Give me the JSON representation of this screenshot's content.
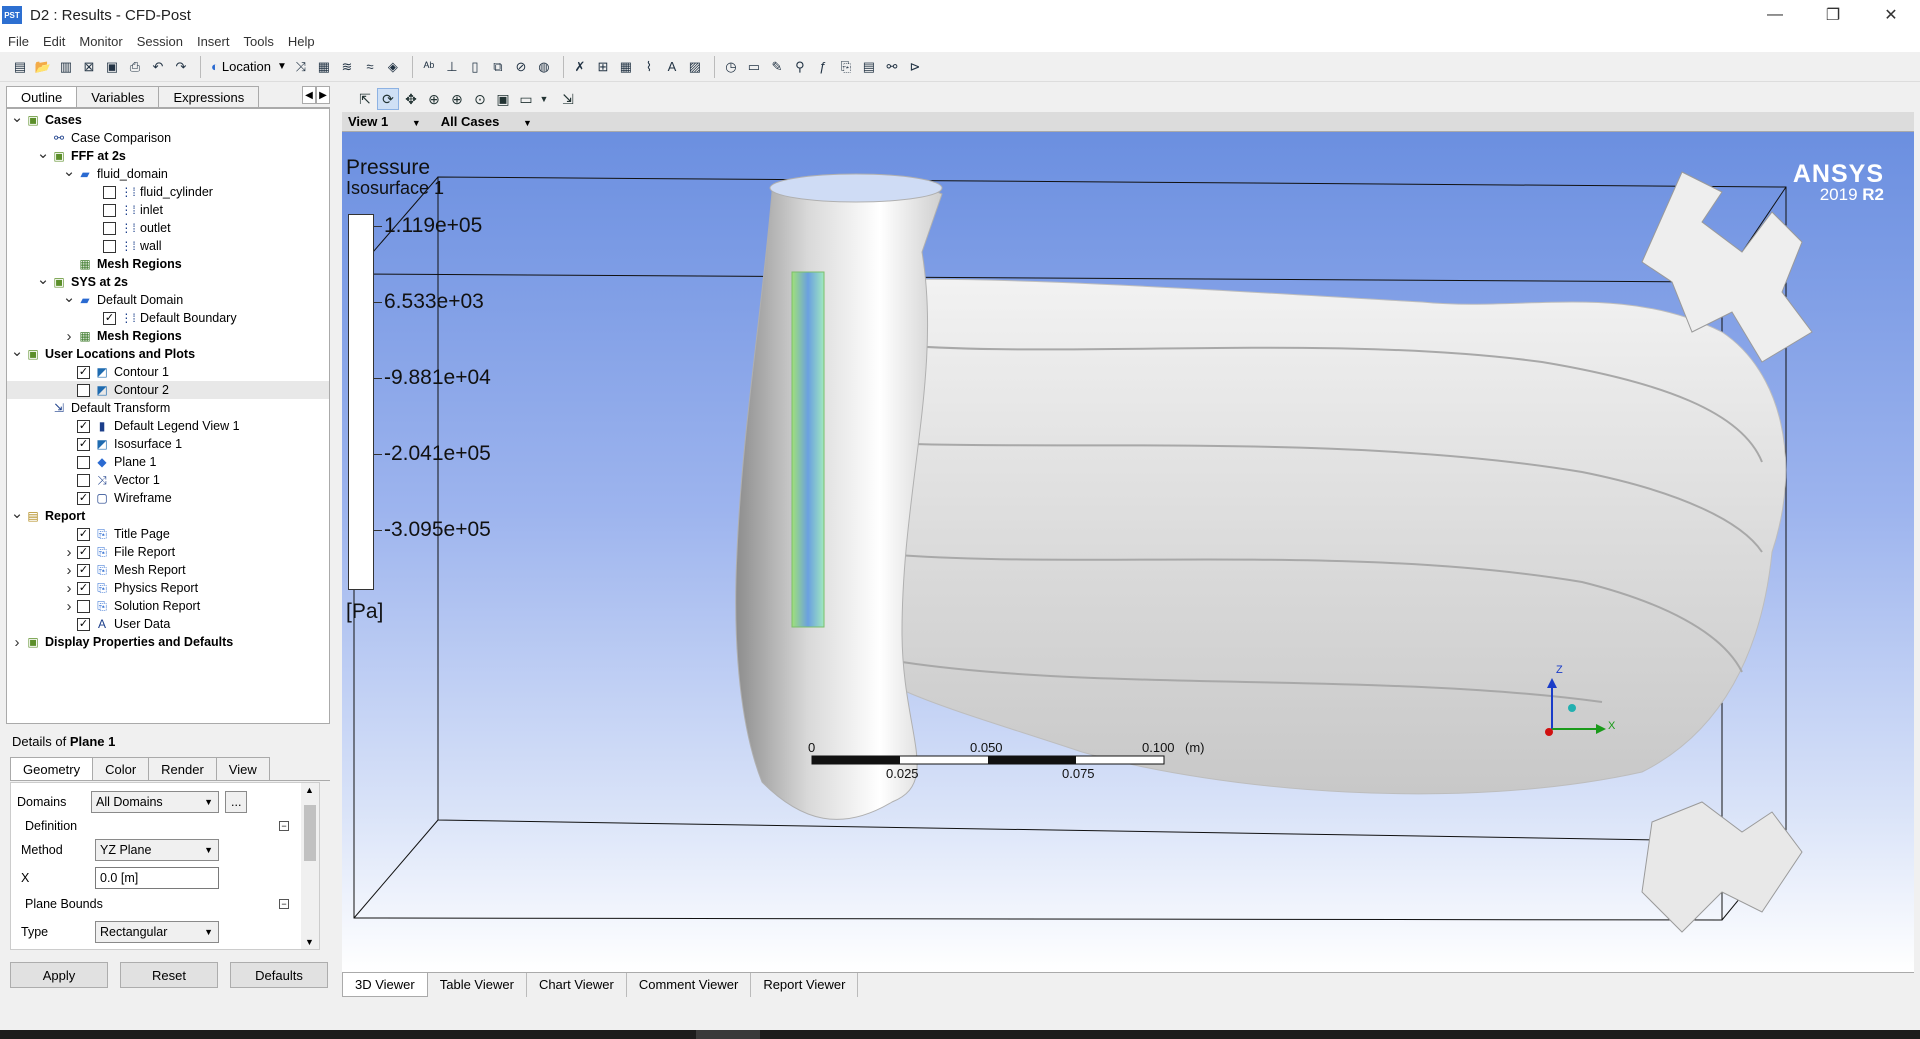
{
  "window": {
    "title": "D2 : Results - CFD-Post",
    "app_icon_text": "PST",
    "minimize": "—",
    "restore": "❐",
    "close": "✕"
  },
  "menu": [
    "File",
    "Edit",
    "Monitor",
    "Session",
    "Insert",
    "Tools",
    "Help"
  ],
  "toolbar": {
    "location_label": "Location"
  },
  "left_tabs": [
    "Outline",
    "Variables",
    "Expressions"
  ],
  "tree": [
    {
      "label": "Cases",
      "level": 0,
      "expand": "open",
      "bold": true,
      "icon": "case"
    },
    {
      "label": "Case Comparison",
      "level": 1,
      "expand": "none",
      "icon": "compare"
    },
    {
      "label": "FFF at 2s",
      "level": 1,
      "expand": "open",
      "bold": true,
      "icon": "case"
    },
    {
      "label": "fluid_domain",
      "level": 2,
      "expand": "open",
      "icon": "domain"
    },
    {
      "label": "fluid_cylinder",
      "level": 3,
      "expand": "none",
      "check": false,
      "icon": "boundary"
    },
    {
      "label": "inlet",
      "level": 3,
      "expand": "none",
      "check": false,
      "icon": "boundary"
    },
    {
      "label": "outlet",
      "level": 3,
      "expand": "none",
      "check": false,
      "icon": "boundary"
    },
    {
      "label": "wall",
      "level": 3,
      "expand": "none",
      "check": false,
      "icon": "boundary"
    },
    {
      "label": "Mesh Regions",
      "level": 2,
      "expand": "none",
      "bold": true,
      "icon": "mesh"
    },
    {
      "label": "SYS at 2s",
      "level": 1,
      "expand": "open",
      "bold": true,
      "icon": "case"
    },
    {
      "label": "Default Domain",
      "level": 2,
      "expand": "open",
      "icon": "domain"
    },
    {
      "label": "Default Boundary",
      "level": 3,
      "expand": "none",
      "check": true,
      "icon": "boundary"
    },
    {
      "label": "Mesh Regions",
      "level": 2,
      "expand": "closed",
      "bold": true,
      "icon": "mesh"
    },
    {
      "label": "User Locations and Plots",
      "level": 0,
      "expand": "open",
      "bold": true,
      "icon": "case"
    },
    {
      "label": "Contour 1",
      "level": 2,
      "expand": "none",
      "check": true,
      "icon": "plot"
    },
    {
      "label": "Contour 2",
      "level": 2,
      "expand": "none",
      "check": false,
      "icon": "plot",
      "selected": true
    },
    {
      "label": "Default Transform",
      "level": 1,
      "expand": "none",
      "icon": "transform"
    },
    {
      "label": "Default Legend View 1",
      "level": 2,
      "expand": "none",
      "check": true,
      "icon": "legend"
    },
    {
      "label": "Isosurface 1",
      "level": 2,
      "expand": "none",
      "check": true,
      "icon": "plot"
    },
    {
      "label": "Plane 1",
      "level": 2,
      "expand": "none",
      "check": false,
      "icon": "plane"
    },
    {
      "label": "Vector 1",
      "level": 2,
      "expand": "none",
      "check": false,
      "icon": "vector"
    },
    {
      "label": "Wireframe",
      "level": 2,
      "expand": "none",
      "check": true,
      "icon": "wire"
    },
    {
      "label": "Report",
      "level": 0,
      "expand": "open",
      "bold": true,
      "icon": "report"
    },
    {
      "label": "Title Page",
      "level": 2,
      "expand": "none",
      "check": true,
      "icon": "page"
    },
    {
      "label": "File Report",
      "level": 2,
      "expand": "closed",
      "check": true,
      "icon": "page"
    },
    {
      "label": "Mesh Report",
      "level": 2,
      "expand": "closed",
      "check": true,
      "icon": "page"
    },
    {
      "label": "Physics Report",
      "level": 2,
      "expand": "closed",
      "check": true,
      "icon": "page"
    },
    {
      "label": "Solution Report",
      "level": 2,
      "expand": "closed",
      "check": false,
      "icon": "page"
    },
    {
      "label": "User Data",
      "level": 2,
      "expand": "none",
      "check": true,
      "icon": "userdata"
    },
    {
      "label": "Display Properties and Defaults",
      "level": 0,
      "expand": "closed",
      "bold": true,
      "icon": "case"
    }
  ],
  "details": {
    "prefix": "Details of ",
    "object": "Plane 1",
    "tabs": [
      "Geometry",
      "Color",
      "Render",
      "View"
    ],
    "domains_label": "Domains",
    "domains_value": "All Domains",
    "ellipsis": "...",
    "definition_label": "Definition",
    "method_label": "Method",
    "method_value": "YZ Plane",
    "x_label": "X",
    "x_value": "0.0 [m]",
    "plane_bounds_label": "Plane Bounds",
    "type_label": "Type",
    "type_value": "Rectangular",
    "apply": "Apply",
    "reset": "Reset",
    "defaults": "Defaults"
  },
  "view": {
    "view_label": "View 1",
    "cases_label": "All Cases"
  },
  "legend": {
    "title": "Pressure",
    "subtitle": "Isosurface 1",
    "values": [
      "1.119e+05",
      "6.533e+03",
      "-9.881e+04",
      "-2.041e+05",
      "-3.095e+05"
    ],
    "unit": "[Pa]"
  },
  "brand": {
    "name": "ANSYS",
    "version_year": "2019",
    "version_release": "R2"
  },
  "scale": {
    "top_labels": [
      "0",
      "0.050",
      "0.100",
      "(m)"
    ],
    "bottom_labels": [
      "0.025",
      "0.075"
    ]
  },
  "axes": {
    "z": "Z",
    "x": "X"
  },
  "bottom_tabs": [
    "3D Viewer",
    "Table Viewer",
    "Chart Viewer",
    "Comment Viewer",
    "Report Viewer"
  ]
}
